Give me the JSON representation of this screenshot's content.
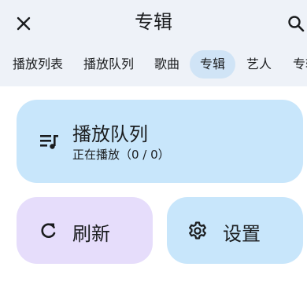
{
  "header": {
    "title": "专辑",
    "close_icon": "close-icon",
    "search_icon": "search-icon"
  },
  "tabs": [
    {
      "label": "播放列表",
      "selected": false
    },
    {
      "label": "播放队列",
      "selected": false
    },
    {
      "label": "歌曲",
      "selected": false
    },
    {
      "label": "专辑",
      "selected": true
    },
    {
      "label": "艺人",
      "selected": false
    },
    {
      "label": "专辑",
      "selected": false
    }
  ],
  "cards": {
    "queue": {
      "title": "播放队列",
      "subtitle": "正在播放（0 / 0）",
      "icon": "queue-music-icon"
    },
    "refresh": {
      "title": "刷新",
      "icon": "refresh-icon"
    },
    "settings": {
      "title": "设置",
      "icon": "gear-icon"
    }
  },
  "colors": {
    "header_bg": "#eef2f8",
    "selected_tab_bg": "#d0e4f6",
    "blue_card": "#c8e6fb",
    "purple_card": "#e6ddfb"
  }
}
